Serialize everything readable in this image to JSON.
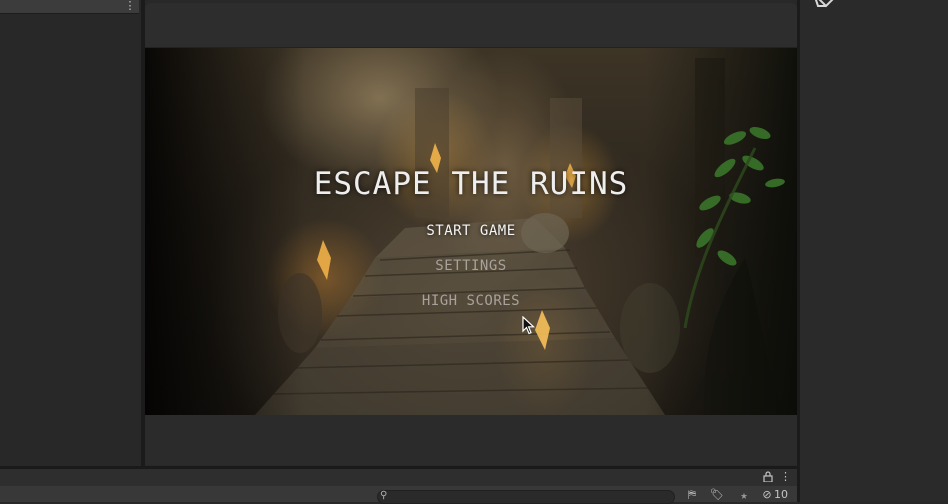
{
  "editor": {
    "left_panel_menu_icon": "kebab-menu-icon",
    "top_right_logo_icon": "unity-logo-icon",
    "bottom_panel": {
      "lock_icon": "lock-icon",
      "menu_icon": "kebab-menu-icon",
      "search": {
        "placeholder": "",
        "value": "",
        "icon": "search-icon"
      },
      "filter_by_type_icon": "filter-by-type-icon",
      "filter_by_label_icon": "tag-icon",
      "favorites_icon": "star-icon",
      "hidden_packages_icon": "eye-slash-icon",
      "hidden_packages_count": "10"
    }
  },
  "game": {
    "title": "ESCAPE THE RUINS",
    "menu": [
      {
        "label": "START GAME",
        "state": "highlighted"
      },
      {
        "label": "SETTINGS",
        "state": "normal"
      },
      {
        "label": "HIGH SCORES",
        "state": "hovered"
      }
    ]
  },
  "colors": {
    "editor_background": "#282828",
    "panel_background": "#2c2c2c",
    "title_text": "#eeeeee",
    "menu_highlighted_text": "#f4f4f4",
    "menu_normal_text": "#a8a29a"
  }
}
